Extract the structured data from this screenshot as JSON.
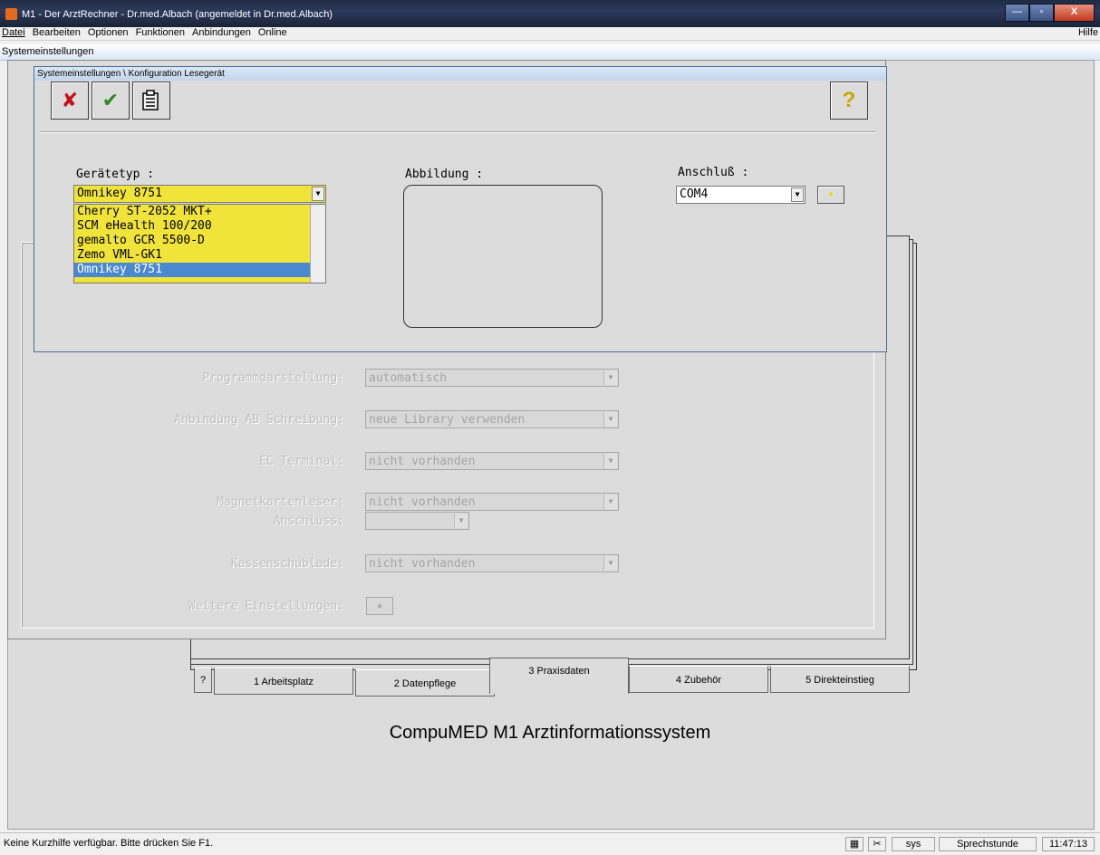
{
  "window": {
    "title": "M1 - Der ArztRechner  -  Dr.med.Albach (angemeldet in Dr.med.Albach)",
    "btn_min": "—",
    "btn_max": "▫",
    "btn_close": "X"
  },
  "menu": {
    "items": [
      "Datei",
      "Bearbeiten",
      "Optionen",
      "Funktionen",
      "Anbindungen",
      "Online"
    ],
    "help": "Hilfe"
  },
  "inner_title": "Systemeinstellungen",
  "dialog": {
    "title": "Systemeinstellungen \\ Konfiguration Lesegerät",
    "help_button": "?",
    "geraetetyp_label": "Gerätetyp :",
    "geraetetyp_value": "Omnikey 8751",
    "geraetetyp_options": [
      "Cherry ST-2052 MKT+",
      "SCM eHealth 100/200",
      "gemalto GCR 5500-D",
      "Zemo VML-GK1",
      "Omnikey 8751"
    ],
    "abbildung_label": "Abbildung :",
    "anschluss_label": "Anschluß :",
    "anschluss_value": "COM4"
  },
  "settings": {
    "programmdarstellung_label": "Programmdarstellung:",
    "programmdarstellung_value": "automatisch",
    "anbindung_label": "Anbindung AB Schreibung:",
    "anbindung_value": "neue Library verwenden",
    "ec_label": "EC Terminal:",
    "ec_value": "nicht vorhanden",
    "magnet_label": "Magnetkartenleser:",
    "magnet_value": "nicht vorhanden",
    "anschluss2_label": "Anschluss:",
    "anschluss2_value": "",
    "kasse_label": "Kassenschublade:",
    "kasse_value": "nicht vorhanden",
    "weitere_label": "Weitere Einstellungen:"
  },
  "tabs": {
    "help": "?",
    "items": [
      "1 Arbeitsplatz",
      "2 Datenpflege",
      "3 Praxisdaten",
      "4 Zubehör",
      "5 Direkteinstieg"
    ]
  },
  "center_title": "CompuMED M1 Arztinformationssystem",
  "status": {
    "message": "Keine Kurzhilfe verfügbar. Bitte drücken Sie F1.",
    "user": "sys",
    "mode": "Sprechstunde",
    "time": "11:47:13"
  },
  "colors": {
    "accent_yellow": "#f0e33a",
    "selection_blue": "#4a89d0",
    "cancel_red": "#c8101a",
    "ok_green": "#2c8a22"
  }
}
